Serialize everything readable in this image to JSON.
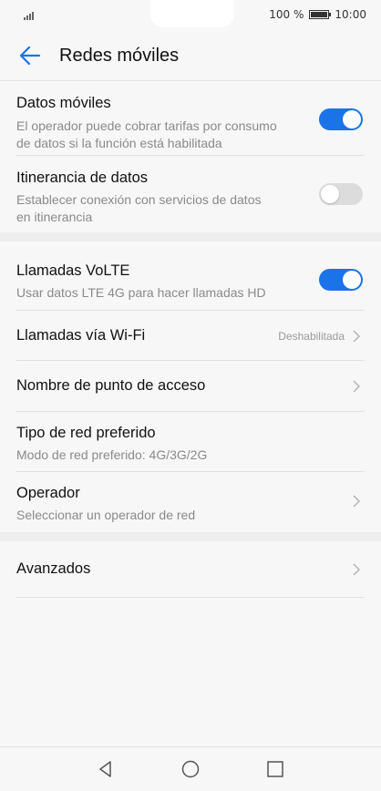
{
  "status": {
    "battery_text": "100 %",
    "time": "10:00"
  },
  "app_bar": {
    "title": "Redes móviles"
  },
  "settings": [
    {
      "title": "Datos móviles",
      "subtitle_line1": "El operador puede cobrar tarifas por consumo",
      "subtitle_line2": "de datos si la función está habilitada",
      "toggle": "on"
    },
    {
      "title": "Itinerancia de datos",
      "subtitle_line1": "Establecer conexión con servicios de datos",
      "subtitle_line2": "en itinerancia",
      "toggle": "off"
    },
    {
      "title": "Llamadas VoLTE",
      "subtitle_line1": "Usar datos LTE 4G para hacer llamadas HD",
      "toggle": "on"
    },
    {
      "title": "Llamadas vía Wi-Fi",
      "value": "Deshabilitada"
    },
    {
      "title": "Nombre de punto de acceso"
    },
    {
      "title": "Tipo de red preferido",
      "subtitle_line1": "Modo de red preferido: 4G/3G/2G"
    },
    {
      "title": "Operador",
      "subtitle_line1": "Seleccionar un operador de red"
    },
    {
      "title": "Avanzados"
    }
  ],
  "colors": {
    "accent": "#1a73e8",
    "toggle_off": "#dcdcdc",
    "background": "#f7f7f7"
  },
  "icons": {
    "back": "arrow-left-icon",
    "chevron": "chevron-right-icon",
    "nav_back": "triangle-back-icon",
    "nav_home": "circle-home-icon",
    "nav_recent": "square-recent-icon"
  }
}
